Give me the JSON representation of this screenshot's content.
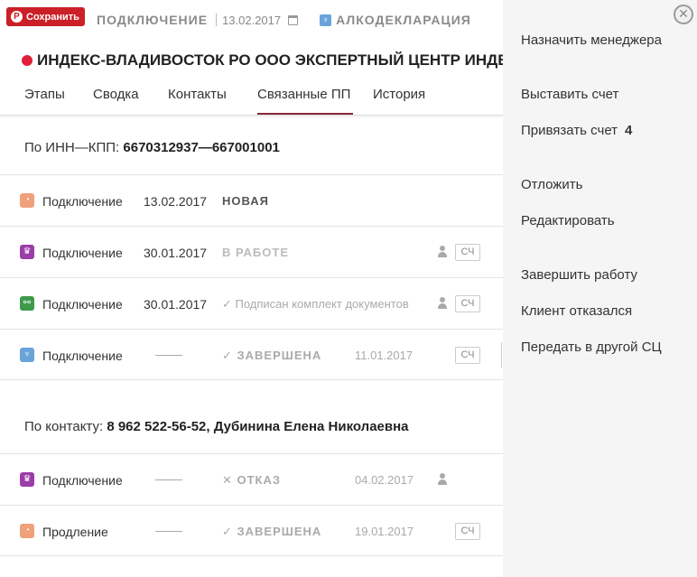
{
  "header": {
    "save_button": "Сохранить",
    "pin_logo": "P",
    "type": "ПОДКЛЮЧЕНИЕ",
    "date": "13.02.2017",
    "product": "АЛКОДЕКЛАРАЦИЯ",
    "product_icon": "wine-glass-icon",
    "title": "ИНДЕКС-ВЛАДИВОСТОК РО ООО ЭКСПЕРТНЫЙ ЦЕНТР ИНДЕКС"
  },
  "tabs": [
    {
      "label": "Этапы"
    },
    {
      "label": "Сводка"
    },
    {
      "label": "Контакты"
    },
    {
      "label": "Связанные ПП"
    },
    {
      "label": "История"
    }
  ],
  "active_tab": "Связанные ПП",
  "section_inn": {
    "label": "По ИНН—КПП:",
    "value": "6670312937—667001001",
    "rows": [
      {
        "icon": "calendar-check-icon",
        "icon_color": "#f0a07a",
        "glyph": "◔",
        "name": "Подключение",
        "date": "13.02.2017",
        "status": "НОВАЯ"
      },
      {
        "icon": "crown-icon",
        "icon_color": "#9b3da8",
        "glyph": "♛",
        "name": "Подключение",
        "date": "30.01.2017",
        "status": "В РАБОТЕ",
        "badge": "СЧ"
      },
      {
        "icon": "share-icon",
        "icon_color": "#3c9a4a",
        "glyph": "⚯",
        "name": "Подключение",
        "date": "30.01.2017",
        "status": "✓ Подписан комплект документов",
        "badge": "СЧ"
      },
      {
        "icon": "wine-glass-icon",
        "icon_color": "#6aa3d9",
        "glyph": "♆",
        "name": "Подключение",
        "status": "✓ ЗАВЕРШЕНА",
        "sub_date": "11.01.2017",
        "badge": "СЧ"
      }
    ]
  },
  "section_contact": {
    "label": "По контакту:",
    "value": "8 962 522-56-52, Дубинина Елена Николаевна",
    "rows": [
      {
        "icon": "crown-icon",
        "icon_color": "#9b3da8",
        "glyph": "♛",
        "name": "Подключение",
        "status": "✕ ОТКАЗ",
        "sub_date": "04.02.2017"
      },
      {
        "icon": "calendar-check-icon",
        "icon_color": "#f0a07a",
        "glyph": "◔",
        "name": "Продление",
        "status": "✓ ЗАВЕРШЕНА",
        "sub_date": "19.01.2017",
        "badge": "СЧ"
      }
    ]
  },
  "panel": {
    "close_glyph": "✕",
    "assign_manager": "Назначить менеджера",
    "issue_invoice": "Выставить счет",
    "link_invoice": "Привязать счет",
    "link_invoice_count": "4",
    "postpone": "Отложить",
    "edit": "Редактировать",
    "finish_work": "Завершить работу",
    "client_refused": "Клиент отказался",
    "transfer": "Передать в другой СЦ"
  }
}
